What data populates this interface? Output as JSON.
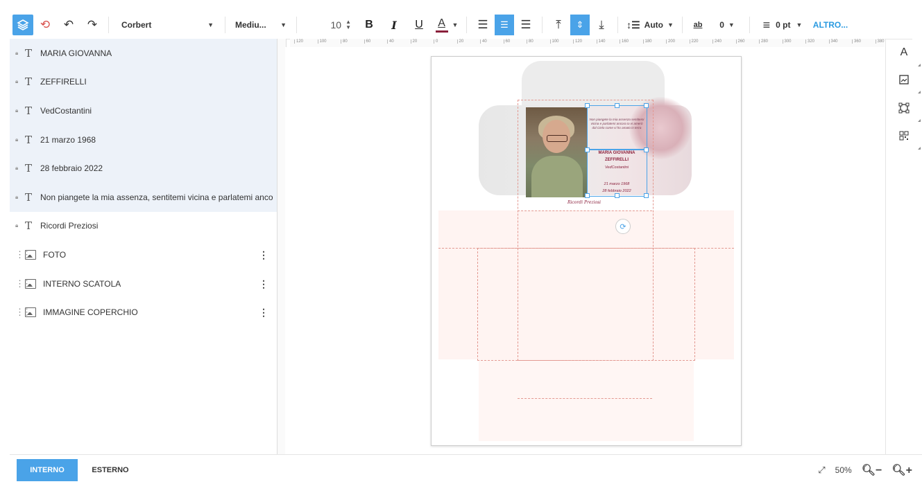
{
  "toolbar": {
    "font_family": "Corbert",
    "font_weight": "Mediu...",
    "font_size": "10",
    "bold": "B",
    "italic": "I",
    "underline": "U",
    "color_letter": "A",
    "line_height": "Auto",
    "letter_spacing_icon": "ab",
    "letter_spacing": "0",
    "border_width": "0 pt",
    "more": "ALTRO...",
    "colors": {
      "accent": "#4aa3e8",
      "text_color": "#8a1f3b"
    }
  },
  "layers": [
    {
      "label": "MARIA GIOVANNA",
      "type": "text",
      "selected": true
    },
    {
      "label": "ZEFFIRELLI",
      "type": "text",
      "selected": true
    },
    {
      "label": "VedCostantini",
      "type": "text",
      "selected": true
    },
    {
      "label": "21 marzo 1968",
      "type": "text",
      "selected": true
    },
    {
      "label": "28 febbraio 2022",
      "type": "text",
      "selected": true
    },
    {
      "label": "Non piangete la mia assenza, sentitemi vicina e parlatemi anco",
      "type": "text",
      "selected": true
    },
    {
      "label": "Ricordi Preziosi",
      "type": "text",
      "selected": false
    },
    {
      "label": "FOTO",
      "type": "image",
      "selected": false
    },
    {
      "label": "INTERNO SCATOLA",
      "type": "image",
      "selected": false
    },
    {
      "label": "IMMAGINE COPERCHIO",
      "type": "image",
      "selected": false
    }
  ],
  "rulers": {
    "horizontal": [
      "120",
      "100",
      "80",
      "60",
      "40",
      "20",
      "0",
      "20",
      "40",
      "60",
      "80",
      "100",
      "120",
      "140",
      "160",
      "180",
      "200",
      "220",
      "240",
      "260",
      "280",
      "300",
      "320",
      "340",
      "360",
      "380"
    ]
  },
  "design": {
    "verse": "Non piangete la mia assenza sentitemi vicina e parlatemi ancora io vi amerò dal Cielo come vi ho amato in terra",
    "name1": "MARIA GIOVANNA",
    "name2": "ZEFFIRELLI",
    "ved": "VedCostantini",
    "date1": "21 marzo 1968",
    "date2": "28 febbraio 2022",
    "signature": "Ricordi Preziosi"
  },
  "right_tools": [
    "text-tool",
    "image-tool",
    "shape-tool",
    "qr-tool"
  ],
  "bottom": {
    "tab_inside": "INTERNO",
    "tab_outside": "ESTERNO",
    "zoom": "50%"
  }
}
